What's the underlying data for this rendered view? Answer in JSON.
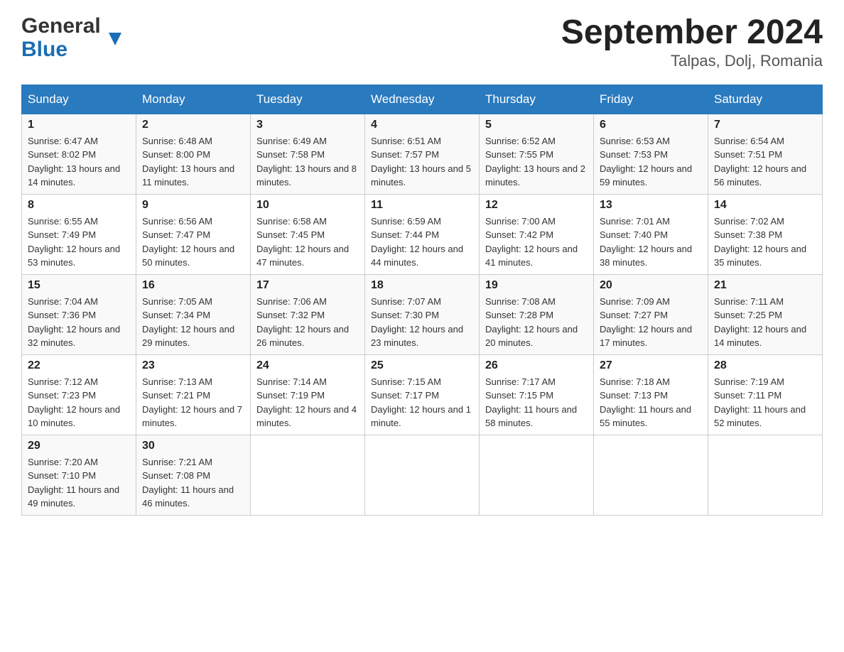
{
  "header": {
    "logo_general": "General",
    "logo_blue": "Blue",
    "month_title": "September 2024",
    "location": "Talpas, Dolj, Romania"
  },
  "weekdays": [
    "Sunday",
    "Monday",
    "Tuesday",
    "Wednesday",
    "Thursday",
    "Friday",
    "Saturday"
  ],
  "weeks": [
    [
      {
        "day": "1",
        "sunrise": "6:47 AM",
        "sunset": "8:02 PM",
        "daylight": "13 hours and 14 minutes."
      },
      {
        "day": "2",
        "sunrise": "6:48 AM",
        "sunset": "8:00 PM",
        "daylight": "13 hours and 11 minutes."
      },
      {
        "day": "3",
        "sunrise": "6:49 AM",
        "sunset": "7:58 PM",
        "daylight": "13 hours and 8 minutes."
      },
      {
        "day": "4",
        "sunrise": "6:51 AM",
        "sunset": "7:57 PM",
        "daylight": "13 hours and 5 minutes."
      },
      {
        "day": "5",
        "sunrise": "6:52 AM",
        "sunset": "7:55 PM",
        "daylight": "13 hours and 2 minutes."
      },
      {
        "day": "6",
        "sunrise": "6:53 AM",
        "sunset": "7:53 PM",
        "daylight": "12 hours and 59 minutes."
      },
      {
        "day": "7",
        "sunrise": "6:54 AM",
        "sunset": "7:51 PM",
        "daylight": "12 hours and 56 minutes."
      }
    ],
    [
      {
        "day": "8",
        "sunrise": "6:55 AM",
        "sunset": "7:49 PM",
        "daylight": "12 hours and 53 minutes."
      },
      {
        "day": "9",
        "sunrise": "6:56 AM",
        "sunset": "7:47 PM",
        "daylight": "12 hours and 50 minutes."
      },
      {
        "day": "10",
        "sunrise": "6:58 AM",
        "sunset": "7:45 PM",
        "daylight": "12 hours and 47 minutes."
      },
      {
        "day": "11",
        "sunrise": "6:59 AM",
        "sunset": "7:44 PM",
        "daylight": "12 hours and 44 minutes."
      },
      {
        "day": "12",
        "sunrise": "7:00 AM",
        "sunset": "7:42 PM",
        "daylight": "12 hours and 41 minutes."
      },
      {
        "day": "13",
        "sunrise": "7:01 AM",
        "sunset": "7:40 PM",
        "daylight": "12 hours and 38 minutes."
      },
      {
        "day": "14",
        "sunrise": "7:02 AM",
        "sunset": "7:38 PM",
        "daylight": "12 hours and 35 minutes."
      }
    ],
    [
      {
        "day": "15",
        "sunrise": "7:04 AM",
        "sunset": "7:36 PM",
        "daylight": "12 hours and 32 minutes."
      },
      {
        "day": "16",
        "sunrise": "7:05 AM",
        "sunset": "7:34 PM",
        "daylight": "12 hours and 29 minutes."
      },
      {
        "day": "17",
        "sunrise": "7:06 AM",
        "sunset": "7:32 PM",
        "daylight": "12 hours and 26 minutes."
      },
      {
        "day": "18",
        "sunrise": "7:07 AM",
        "sunset": "7:30 PM",
        "daylight": "12 hours and 23 minutes."
      },
      {
        "day": "19",
        "sunrise": "7:08 AM",
        "sunset": "7:28 PM",
        "daylight": "12 hours and 20 minutes."
      },
      {
        "day": "20",
        "sunrise": "7:09 AM",
        "sunset": "7:27 PM",
        "daylight": "12 hours and 17 minutes."
      },
      {
        "day": "21",
        "sunrise": "7:11 AM",
        "sunset": "7:25 PM",
        "daylight": "12 hours and 14 minutes."
      }
    ],
    [
      {
        "day": "22",
        "sunrise": "7:12 AM",
        "sunset": "7:23 PM",
        "daylight": "12 hours and 10 minutes."
      },
      {
        "day": "23",
        "sunrise": "7:13 AM",
        "sunset": "7:21 PM",
        "daylight": "12 hours and 7 minutes."
      },
      {
        "day": "24",
        "sunrise": "7:14 AM",
        "sunset": "7:19 PM",
        "daylight": "12 hours and 4 minutes."
      },
      {
        "day": "25",
        "sunrise": "7:15 AM",
        "sunset": "7:17 PM",
        "daylight": "12 hours and 1 minute."
      },
      {
        "day": "26",
        "sunrise": "7:17 AM",
        "sunset": "7:15 PM",
        "daylight": "11 hours and 58 minutes."
      },
      {
        "day": "27",
        "sunrise": "7:18 AM",
        "sunset": "7:13 PM",
        "daylight": "11 hours and 55 minutes."
      },
      {
        "day": "28",
        "sunrise": "7:19 AM",
        "sunset": "7:11 PM",
        "daylight": "11 hours and 52 minutes."
      }
    ],
    [
      {
        "day": "29",
        "sunrise": "7:20 AM",
        "sunset": "7:10 PM",
        "daylight": "11 hours and 49 minutes."
      },
      {
        "day": "30",
        "sunrise": "7:21 AM",
        "sunset": "7:08 PM",
        "daylight": "11 hours and 46 minutes."
      },
      null,
      null,
      null,
      null,
      null
    ]
  ]
}
